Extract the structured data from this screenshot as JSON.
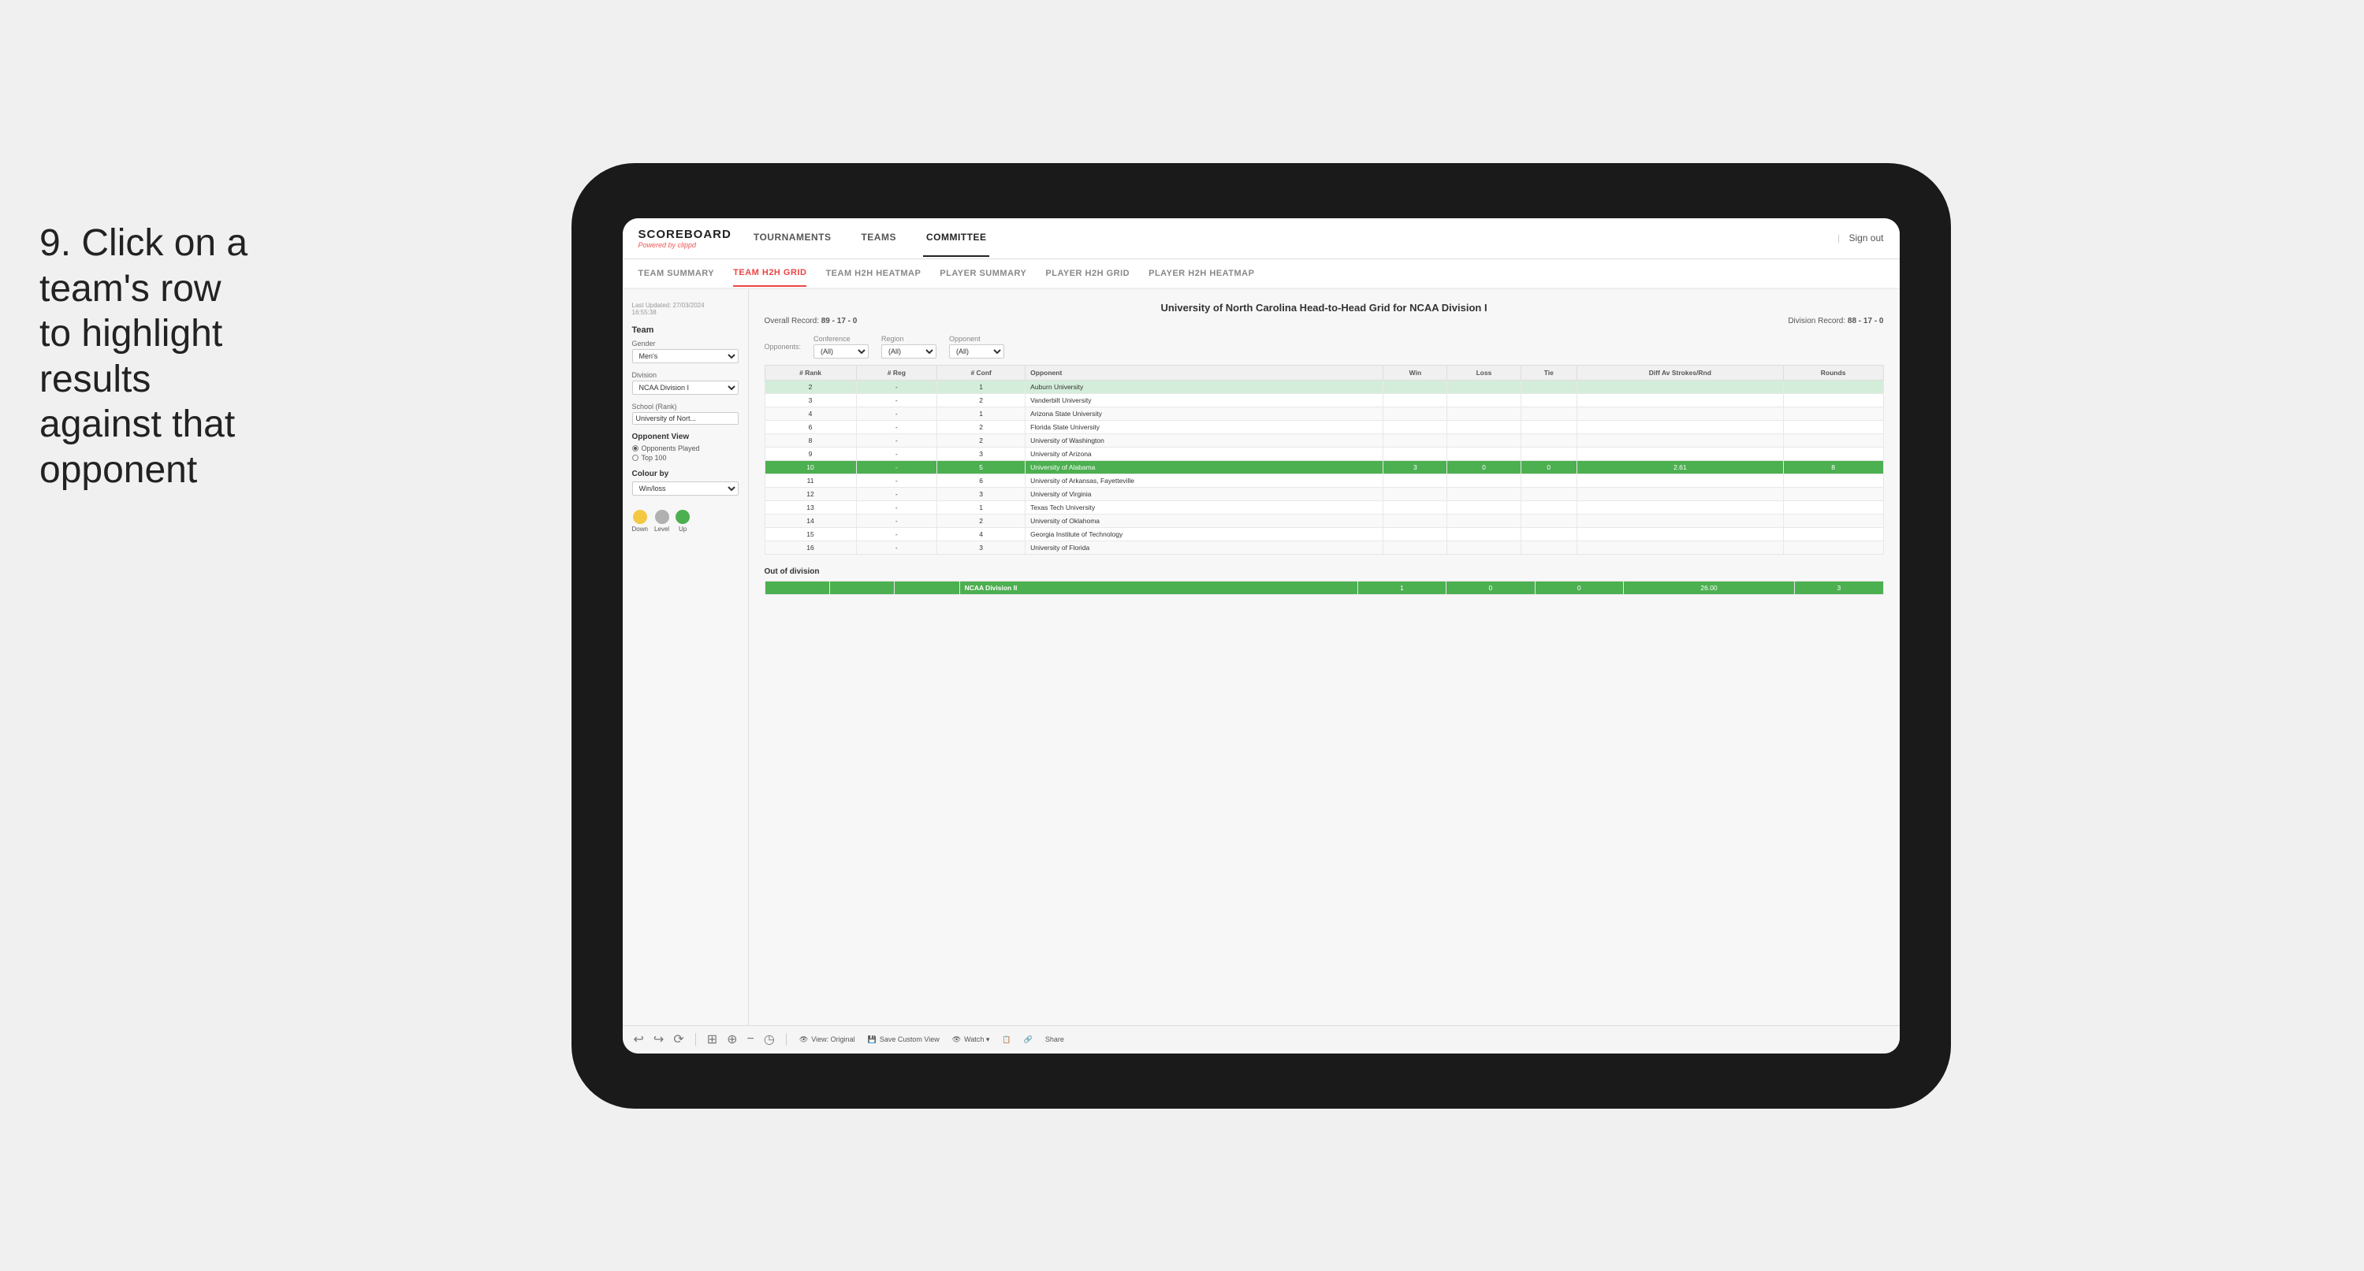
{
  "instruction": {
    "step": "9.",
    "text": "Click on a team's row to highlight results against that opponent"
  },
  "nav": {
    "logo": "SCOREBOARD",
    "logo_subtitle": "Powered by",
    "logo_brand": "clippd",
    "items": [
      "TOURNAMENTS",
      "TEAMS",
      "COMMITTEE"
    ],
    "active_item": "COMMITTEE",
    "sign_out": "Sign out"
  },
  "sub_nav": {
    "items": [
      "TEAM SUMMARY",
      "TEAM H2H GRID",
      "TEAM H2H HEATMAP",
      "PLAYER SUMMARY",
      "PLAYER H2H GRID",
      "PLAYER H2H HEATMAP"
    ],
    "active_item": "TEAM H2H GRID"
  },
  "sidebar": {
    "last_updated_label": "Last Updated: 27/03/2024",
    "last_updated_time": "16:55:38",
    "team_label": "Team",
    "gender_label": "Gender",
    "gender_value": "Men's",
    "division_label": "Division",
    "division_value": "NCAA Division I",
    "school_rank_label": "School (Rank)",
    "school_rank_value": "University of Nort...",
    "opponent_view_title": "Opponent View",
    "radio_options": [
      "Opponents Played",
      "Top 100"
    ],
    "selected_radio": "Opponents Played",
    "colour_by_title": "Colour by",
    "colour_by_value": "Win/loss",
    "legend": [
      {
        "label": "Down",
        "color": "#f5c842"
      },
      {
        "label": "Level",
        "color": "#b0b0b0"
      },
      {
        "label": "Up",
        "color": "#4caf50"
      }
    ]
  },
  "content": {
    "title": "University of North Carolina Head-to-Head Grid for NCAA Division I",
    "overall_record_label": "Overall Record:",
    "overall_record": "89 - 17 - 0",
    "division_record_label": "Division Record:",
    "division_record": "88 - 17 - 0",
    "filters": {
      "opponents_label": "Opponents:",
      "opponents_value": "(All)",
      "conference_label": "Conference",
      "conference_value": "(All)",
      "region_label": "Region",
      "region_value": "(All)",
      "opponent_label": "Opponent",
      "opponent_value": "(All)"
    },
    "table_headers": [
      "# Rank",
      "# Reg",
      "# Conf",
      "Opponent",
      "Win",
      "Loss",
      "Tie",
      "Diff Av Strokes/Rnd",
      "Rounds"
    ],
    "rows": [
      {
        "rank": "2",
        "reg": "-",
        "conf": "1",
        "opponent": "Auburn University",
        "win": "",
        "loss": "",
        "tie": "",
        "diff": "",
        "rounds": "",
        "style": "light-green"
      },
      {
        "rank": "3",
        "reg": "-",
        "conf": "2",
        "opponent": "Vanderbilt University",
        "win": "",
        "loss": "",
        "tie": "",
        "diff": "",
        "rounds": "",
        "style": "very-light"
      },
      {
        "rank": "4",
        "reg": "-",
        "conf": "1",
        "opponent": "Arizona State University",
        "win": "",
        "loss": "",
        "tie": "",
        "diff": "",
        "rounds": "",
        "style": "very-light"
      },
      {
        "rank": "6",
        "reg": "-",
        "conf": "2",
        "opponent": "Florida State University",
        "win": "",
        "loss": "",
        "tie": "",
        "diff": "",
        "rounds": "",
        "style": "very-light"
      },
      {
        "rank": "8",
        "reg": "-",
        "conf": "2",
        "opponent": "University of Washington",
        "win": "",
        "loss": "",
        "tie": "",
        "diff": "",
        "rounds": "",
        "style": "very-light"
      },
      {
        "rank": "9",
        "reg": "-",
        "conf": "3",
        "opponent": "University of Arizona",
        "win": "",
        "loss": "",
        "tie": "",
        "diff": "",
        "rounds": "",
        "style": "very-light"
      },
      {
        "rank": "10",
        "reg": "-",
        "conf": "5",
        "opponent": "University of Alabama",
        "win": "3",
        "loss": "0",
        "tie": "0",
        "diff": "2.61",
        "rounds": "8",
        "style": "selected"
      },
      {
        "rank": "11",
        "reg": "-",
        "conf": "6",
        "opponent": "University of Arkansas, Fayetteville",
        "win": "",
        "loss": "",
        "tie": "",
        "diff": "",
        "rounds": "",
        "style": "very-light"
      },
      {
        "rank": "12",
        "reg": "-",
        "conf": "3",
        "opponent": "University of Virginia",
        "win": "",
        "loss": "",
        "tie": "",
        "diff": "",
        "rounds": "",
        "style": "very-light"
      },
      {
        "rank": "13",
        "reg": "-",
        "conf": "1",
        "opponent": "Texas Tech University",
        "win": "",
        "loss": "",
        "tie": "",
        "diff": "",
        "rounds": "",
        "style": "very-light"
      },
      {
        "rank": "14",
        "reg": "-",
        "conf": "2",
        "opponent": "University of Oklahoma",
        "win": "",
        "loss": "",
        "tie": "",
        "diff": "",
        "rounds": "",
        "style": "very-light"
      },
      {
        "rank": "15",
        "reg": "-",
        "conf": "4",
        "opponent": "Georgia Institute of Technology",
        "win": "",
        "loss": "",
        "tie": "",
        "diff": "",
        "rounds": "",
        "style": "very-light"
      },
      {
        "rank": "16",
        "reg": "-",
        "conf": "3",
        "opponent": "University of Florida",
        "win": "",
        "loss": "",
        "tie": "",
        "diff": "",
        "rounds": "",
        "style": "very-light"
      }
    ],
    "out_of_division_label": "Out of division",
    "out_of_division_rows": [
      {
        "opponent": "NCAA Division II",
        "win": "1",
        "loss": "0",
        "tie": "0",
        "diff": "26.00",
        "rounds": "3",
        "style": "selected"
      }
    ]
  },
  "toolbar": {
    "buttons": [
      "↩",
      "↪",
      "⟳",
      "⊞",
      "⊕",
      "−",
      "◷"
    ],
    "actions": [
      "View: Original",
      "Save Custom View",
      "Watch ▾",
      "📋",
      "🔗",
      "Share"
    ]
  }
}
